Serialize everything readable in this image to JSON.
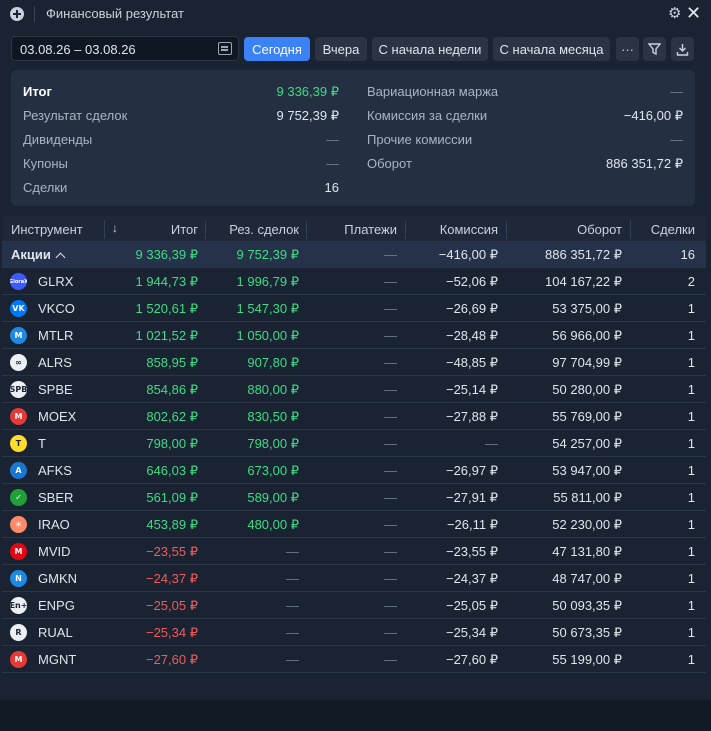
{
  "window": {
    "title": "Финансовый результат"
  },
  "toolbar": {
    "date_range": "03.08.26 – 03.08.26",
    "buttons": [
      "Сегодня",
      "Вчера",
      "С начала недели",
      "С начала месяца"
    ],
    "active_button": "Сегодня",
    "more_label": "···"
  },
  "summary": {
    "left": [
      {
        "label": "Итог",
        "value": "9 336,39 ₽"
      },
      {
        "label": "Результат сделок",
        "value": "9 752,39 ₽"
      },
      {
        "label": "Дивиденды",
        "value": "—"
      },
      {
        "label": "Купоны",
        "value": "—"
      },
      {
        "label": "Сделки",
        "value": "16"
      }
    ],
    "right": [
      {
        "label": "Вариационная маржа",
        "value": "—"
      },
      {
        "label": "Комиссия за сделки",
        "value": "−416,00 ₽"
      },
      {
        "label": "Прочие комиссии",
        "value": "—"
      },
      {
        "label": "Оборот",
        "value": "886 351,72 ₽"
      }
    ]
  },
  "table": {
    "headers": [
      "Инструмент",
      "Итог",
      "Рез. сделок",
      "Платежи",
      "Комиссия",
      "Оборот",
      "Сделки"
    ],
    "sort_icon": "↓",
    "group": {
      "name": "Акции",
      "total": "9 336,39 ₽",
      "result": "9 752,39 ₽",
      "payments": "—",
      "commission": "−416,00 ₽",
      "turnover": "886 351,72 ₽",
      "deals": "16"
    },
    "rows": [
      {
        "ticker": "GLRX",
        "total": "1 944,73 ₽",
        "result": "1 996,79 ₽",
        "payments": "—",
        "commission": "−52,06 ₽",
        "turnover": "104 167,22 ₽",
        "deals": "2",
        "sign": "pos",
        "logo_text": "GlorаX",
        "logo_color": "#3d5afe"
      },
      {
        "ticker": "VKCO",
        "total": "1 520,61 ₽",
        "result": "1 547,30 ₽",
        "payments": "—",
        "commission": "−26,69 ₽",
        "turnover": "53 375,00 ₽",
        "deals": "1",
        "sign": "pos",
        "logo_text": "VK",
        "logo_color": "#0077ff"
      },
      {
        "ticker": "MTLR",
        "total": "1 021,52 ₽",
        "result": "1 050,00 ₽",
        "payments": "—",
        "commission": "−28,48 ₽",
        "turnover": "56 966,00 ₽",
        "deals": "1",
        "sign": "pos",
        "logo_text": "M",
        "logo_color": "#1e88e5"
      },
      {
        "ticker": "ALRS",
        "total": "858,95 ₽",
        "result": "907,80 ₽",
        "payments": "—",
        "commission": "−48,85 ₽",
        "turnover": "97 704,99 ₽",
        "deals": "1",
        "sign": "pos",
        "logo_text": "∞",
        "logo_color": "#eceff4"
      },
      {
        "ticker": "SPBE",
        "total": "854,86 ₽",
        "result": "880,00 ₽",
        "payments": "—",
        "commission": "−25,14 ₽",
        "turnover": "50 280,00 ₽",
        "deals": "1",
        "sign": "pos",
        "logo_text": "SPB",
        "logo_color": "#eceff4"
      },
      {
        "ticker": "MOEX",
        "total": "802,62 ₽",
        "result": "830,50 ₽",
        "payments": "—",
        "commission": "−27,88 ₽",
        "turnover": "55 769,00 ₽",
        "deals": "1",
        "sign": "pos",
        "logo_text": "M",
        "logo_color": "#e53935"
      },
      {
        "ticker": "T",
        "total": "798,00 ₽",
        "result": "798,00 ₽",
        "payments": "—",
        "commission": "—",
        "turnover": "54 257,00 ₽",
        "deals": "1",
        "sign": "pos",
        "logo_text": "T",
        "logo_color": "#ffdd2d"
      },
      {
        "ticker": "AFKS",
        "total": "646,03 ₽",
        "result": "673,00 ₽",
        "payments": "—",
        "commission": "−26,97 ₽",
        "turnover": "53 947,00 ₽",
        "deals": "1",
        "sign": "pos",
        "logo_text": "A",
        "logo_color": "#1976d2"
      },
      {
        "ticker": "SBER",
        "total": "561,09 ₽",
        "result": "589,00 ₽",
        "payments": "—",
        "commission": "−27,91 ₽",
        "turnover": "55 811,00 ₽",
        "deals": "1",
        "sign": "pos",
        "logo_text": "✓",
        "logo_color": "#21a038"
      },
      {
        "ticker": "IRAO",
        "total": "453,89 ₽",
        "result": "480,00 ₽",
        "payments": "—",
        "commission": "−26,11 ₽",
        "turnover": "52 230,00 ₽",
        "deals": "1",
        "sign": "pos",
        "logo_text": "☀",
        "logo_color": "#ff8a65"
      },
      {
        "ticker": "MVID",
        "total": "−23,55 ₽",
        "result": "—",
        "payments": "—",
        "commission": "−23,55 ₽",
        "turnover": "47 131,80 ₽",
        "deals": "1",
        "sign": "neg",
        "logo_text": "М",
        "logo_color": "#e30613"
      },
      {
        "ticker": "GMKN",
        "total": "−24,37 ₽",
        "result": "—",
        "payments": "—",
        "commission": "−24,37 ₽",
        "turnover": "48 747,00 ₽",
        "deals": "1",
        "sign": "neg",
        "logo_text": "N",
        "logo_color": "#1e88e5"
      },
      {
        "ticker": "ENPG",
        "total": "−25,05 ₽",
        "result": "—",
        "payments": "—",
        "commission": "−25,05 ₽",
        "turnover": "50 093,35 ₽",
        "deals": "1",
        "sign": "neg",
        "logo_text": "En+",
        "logo_color": "#eceff4"
      },
      {
        "ticker": "RUAL",
        "total": "−25,34 ₽",
        "result": "—",
        "payments": "—",
        "commission": "−25,34 ₽",
        "turnover": "50 673,35 ₽",
        "deals": "1",
        "sign": "neg",
        "logo_text": "R",
        "logo_color": "#eceff4"
      },
      {
        "ticker": "MGNT",
        "total": "−27,60 ₽",
        "result": "—",
        "payments": "—",
        "commission": "−27,60 ₽",
        "turnover": "55 199,00 ₽",
        "deals": "1",
        "sign": "neg",
        "logo_text": "М",
        "logo_color": "#e53935"
      }
    ]
  }
}
